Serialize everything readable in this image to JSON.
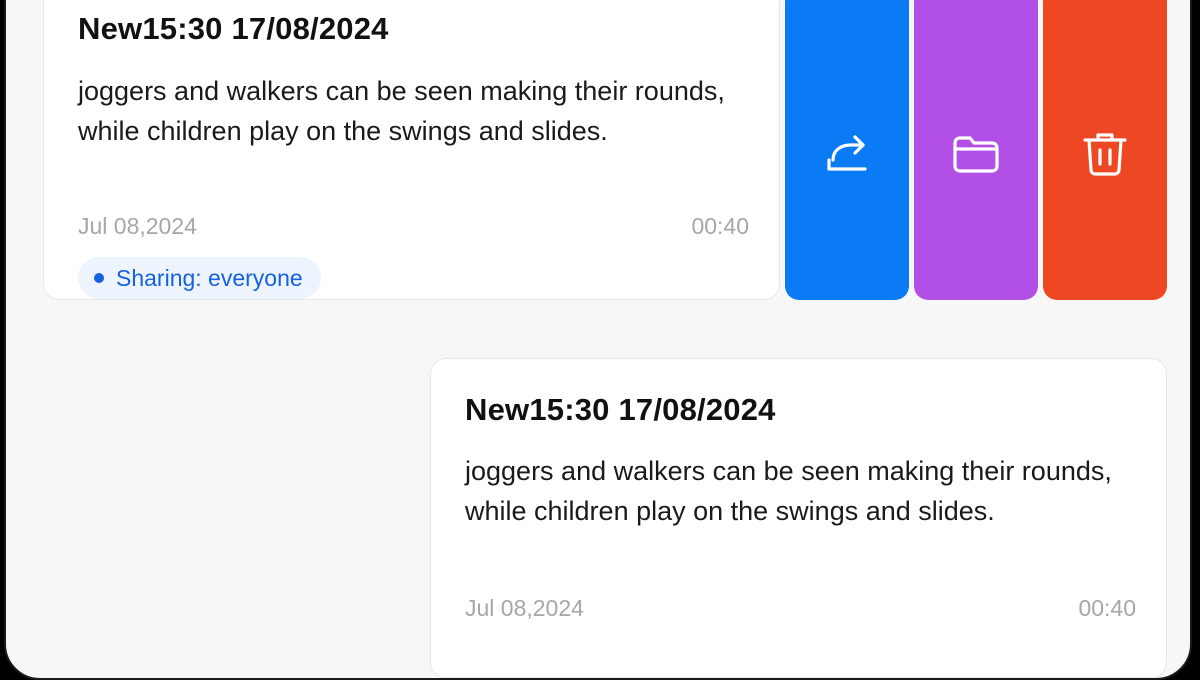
{
  "notes": [
    {
      "title": "New15:30 17/08/2024",
      "body": "joggers and walkers can be seen making their rounds, while children play on the swings and slides.",
      "date": "Jul 08,2024",
      "duration": "00:40",
      "sharing": "Sharing: everyone"
    },
    {
      "title": "New15:30 17/08/2024",
      "body": "joggers and walkers can be seen making their rounds, while children play on the swings and slides.",
      "date": "Jul 08,2024",
      "duration": "00:40"
    }
  ],
  "actions": {
    "share_icon": "share-arrow-icon",
    "folder_icon": "folder-icon",
    "delete_icon": "trash-icon"
  },
  "colors": {
    "share": "#0A7BF5",
    "folder": "#B14FE6",
    "delete": "#ED4723",
    "chip_text": "#1561E0",
    "chip_bg": "#EEF4FE",
    "meta_text": "#A6A6AB"
  }
}
